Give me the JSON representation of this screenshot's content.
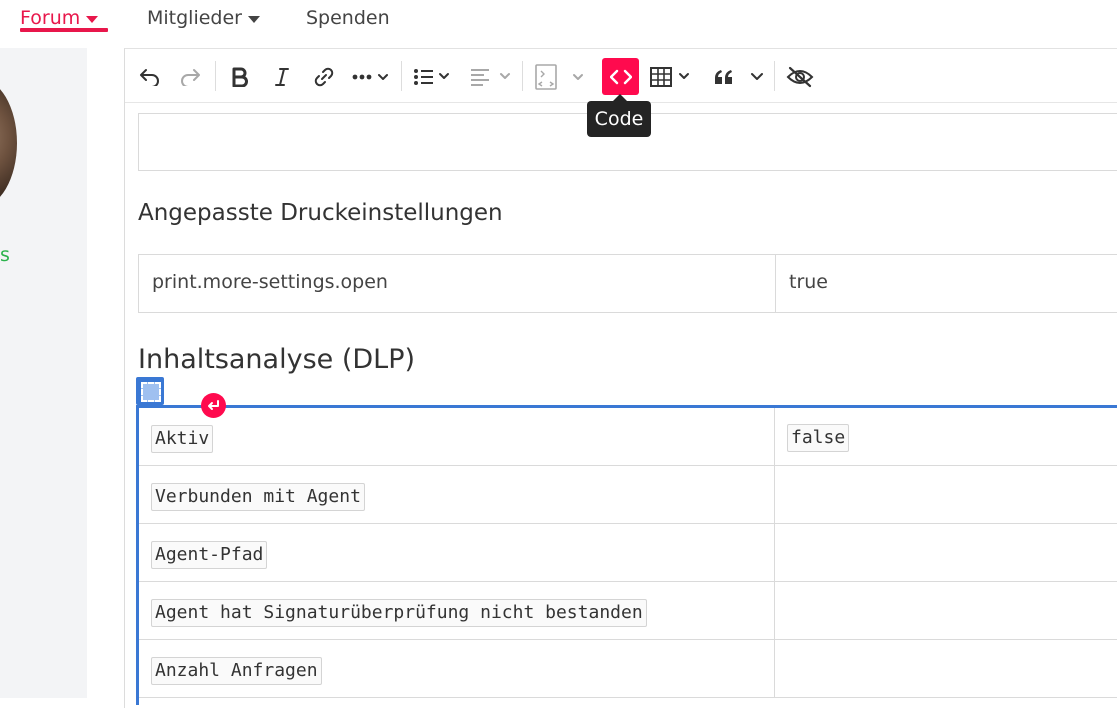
{
  "nav": {
    "forum": "Forum",
    "members": "Mitglieder",
    "donate": "Spenden"
  },
  "sidebar": {
    "status_text": "s"
  },
  "toolbar": {
    "tooltip": "Code",
    "accent_color": "#ff0a4e"
  },
  "content": {
    "print_heading": "Angepasste Druckeinstellungen",
    "print_rows": [
      {
        "key": "print.more-settings.open",
        "value": "true"
      }
    ],
    "dlp_heading": "Inhaltsanalyse (DLP)",
    "dlp_rows": [
      {
        "key": "Aktiv",
        "value": "false"
      },
      {
        "key": "Verbunden mit Agent",
        "value": ""
      },
      {
        "key": "Agent-Pfad",
        "value": ""
      },
      {
        "key": "Agent hat Signaturüberprüfung nicht bestanden",
        "value": ""
      },
      {
        "key": "Anzahl Anfragen",
        "value": ""
      }
    ]
  }
}
